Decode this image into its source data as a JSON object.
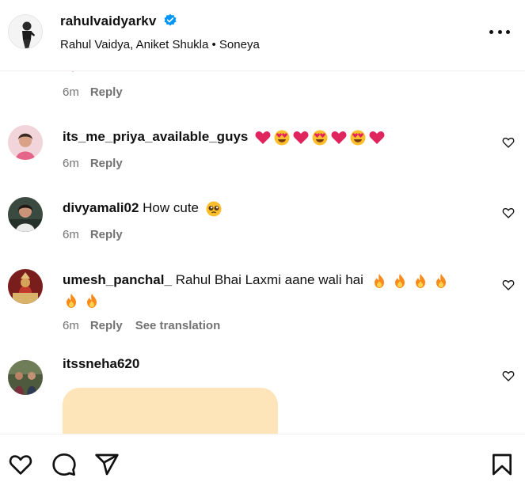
{
  "post": {
    "username": "rahulvaidyarkv",
    "subtitle": "Rahul Vaidya, Aniket Shukla • Soneya"
  },
  "icons": {
    "verified": "verified-badge-icon",
    "more": "more-options-icon",
    "like": "heart-icon",
    "comment": "comment-bubble-icon",
    "share": "paper-plane-icon",
    "save": "bookmark-icon"
  },
  "colors": {
    "verified": "#0095f6",
    "meta": "#737373",
    "preview_bg": "#fde4b9",
    "heart_red": "#e0245e",
    "flame": "#f98a1b"
  },
  "prev_comment": {
    "time": "6m",
    "reply": "Reply"
  },
  "comments": [
    {
      "username": "its_me_priya_available_guys",
      "text": "",
      "emojis": [
        "heart",
        "heart-eyes",
        "heart",
        "heart-eyes",
        "heart",
        "heart-eyes",
        "heart"
      ],
      "time": "6m",
      "reply": "Reply"
    },
    {
      "username": "divyamali02",
      "text": "How cute",
      "emojis": [
        "pleading-face"
      ],
      "time": "6m",
      "reply": "Reply"
    },
    {
      "username": "umesh_panchal_",
      "text": "Rahul Bhai Laxmi aane wali hai",
      "emojis": [
        "fire",
        "fire",
        "fire",
        "fire",
        "fire",
        "fire"
      ],
      "time": "6m",
      "reply": "Reply",
      "translate": "See translation"
    },
    {
      "username": "itssneha620",
      "text": "",
      "time": "",
      "reply": ""
    }
  ]
}
